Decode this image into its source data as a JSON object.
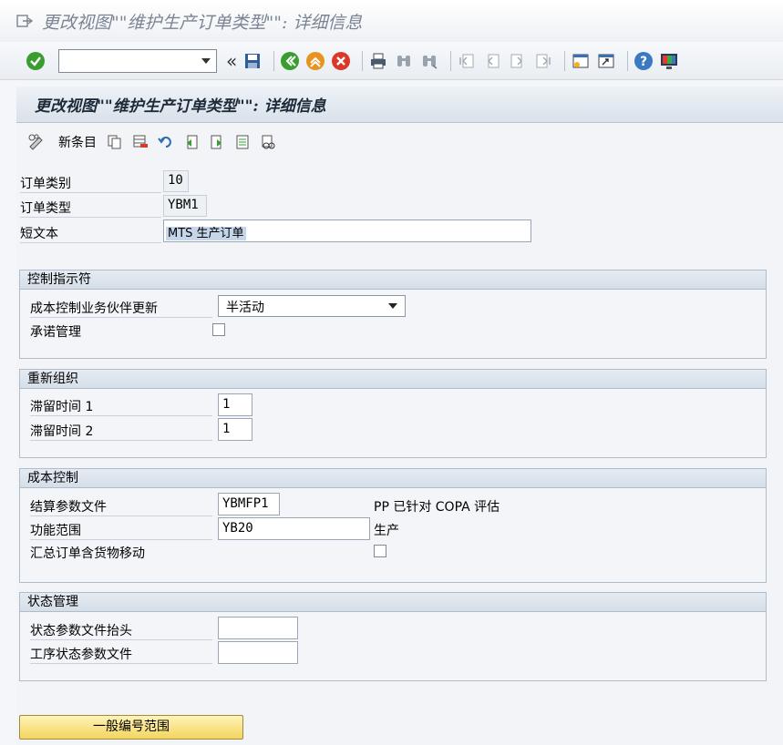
{
  "window": {
    "title": "更改视图\"\"维护生产订单类型\"\": 详细信息"
  },
  "toolbar": {
    "command_value": "",
    "back_chevrons": "«"
  },
  "screen": {
    "title": "更改视图\"\"维护生产订单类型\"\": 详细信息",
    "new_entries_label": "新条目"
  },
  "header_fields": {
    "order_category_label": "订单类别",
    "order_category_value": "10",
    "order_type_label": "订单类型",
    "order_type_value": "YBM1",
    "short_text_label": "短文本",
    "short_text_value": "MTS 生产订单"
  },
  "control_indicators": {
    "title": "控制指示符",
    "cost_control_label": "成本控制业务伙伴更新",
    "cost_control_value": "半活动",
    "commitment_label": "承诺管理"
  },
  "reorganization": {
    "title": "重新组织",
    "residence1_label": "滞留时间 1",
    "residence1_value": "1",
    "residence2_label": "滞留时间 2",
    "residence2_value": "1"
  },
  "cost_control": {
    "title": "成本控制",
    "settlement_label": "结算参数文件",
    "settlement_value": "YBMFP1",
    "settlement_desc": "PP 已针对 COPA 评估",
    "functional_area_label": "功能范围",
    "functional_area_value": "YB20",
    "functional_area_desc": "生产",
    "collective_label": "汇总订单含货物移动"
  },
  "status_management": {
    "title": "状态管理",
    "header_profile_label": "状态参数文件抬头",
    "header_profile_value": "",
    "operation_profile_label": "工序状态参数文件",
    "operation_profile_value": ""
  },
  "footer": {
    "number_range_button": "一般编号范围"
  },
  "colors": {
    "accent_green": "#3a9d2f",
    "accent_orange": "#e07b1a",
    "cancel_red": "#d9382b",
    "button_yellow": "#f3d55f"
  }
}
